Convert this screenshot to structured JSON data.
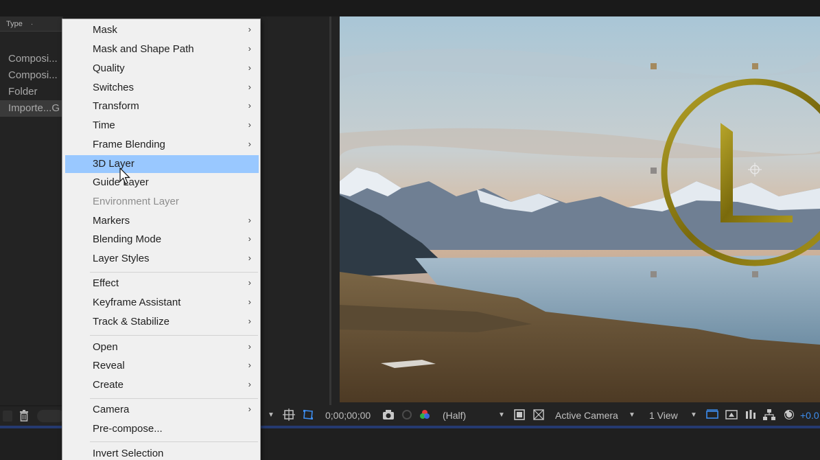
{
  "project": {
    "column_type": "Type",
    "sort_indicator": ".",
    "rows": [
      {
        "label": "Composi..."
      },
      {
        "label": "Composi..."
      },
      {
        "label": "Folder"
      },
      {
        "label": "Importe...G"
      }
    ],
    "footer_dot": "."
  },
  "menu": {
    "items": [
      {
        "label": "Mask",
        "submenu": true
      },
      {
        "label": "Mask and Shape Path",
        "submenu": true
      },
      {
        "label": "Quality",
        "submenu": true
      },
      {
        "label": "Switches",
        "submenu": true
      },
      {
        "label": "Transform",
        "submenu": true
      },
      {
        "label": "Time",
        "submenu": true
      },
      {
        "label": "Frame Blending",
        "submenu": true
      },
      {
        "label": "3D Layer",
        "submenu": false,
        "highlighted": true
      },
      {
        "label": "Guide Layer",
        "submenu": false
      },
      {
        "label": "Environment Layer",
        "submenu": false,
        "disabled": true
      },
      {
        "label": "Markers",
        "submenu": true
      },
      {
        "label": "Blending Mode",
        "submenu": true
      },
      {
        "label": "Layer Styles",
        "submenu": true
      },
      {
        "label": "Effect",
        "submenu": true
      },
      {
        "label": "Keyframe Assistant",
        "submenu": true
      },
      {
        "label": "Track & Stabilize",
        "submenu": true
      },
      {
        "label": "Open",
        "submenu": true
      },
      {
        "label": "Reveal",
        "submenu": true
      },
      {
        "label": "Create",
        "submenu": true
      },
      {
        "label": "Camera",
        "submenu": true
      },
      {
        "label": "Pre-compose...",
        "submenu": false
      },
      {
        "label": "Invert Selection",
        "submenu": false
      }
    ],
    "arrow_glyph": "›"
  },
  "viewer_toolbar": {
    "timecode": "0;00;00;00",
    "resolution": "(Half)",
    "camera": "Active Camera",
    "views": "1 View",
    "exposure": "+0.0"
  },
  "colors": {
    "menu_highlight": "#99c8ff",
    "accent_blue": "#3d8ef0",
    "logo_gold": "#8a7a10"
  },
  "icons": {
    "trash": "trash-icon",
    "camera": "camera-icon",
    "color_channels": "channels-icon",
    "region": "region-of-interest-icon",
    "transparency": "transparency-grid-icon",
    "mask_toggle": "mask-visibility-icon",
    "reset_exposure": "reset-exposure-icon"
  }
}
